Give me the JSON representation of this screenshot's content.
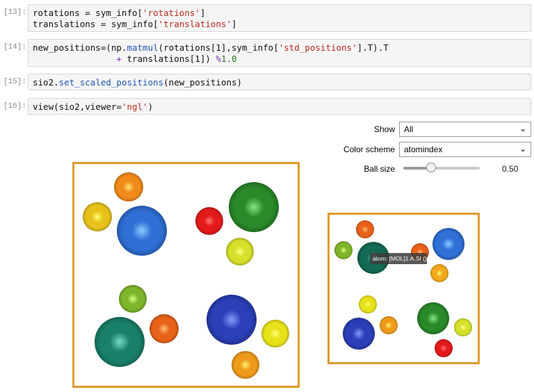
{
  "cells": [
    {
      "prompt": "[13]:",
      "lines": [
        [
          {
            "t": "rotations = sym_info[",
            "c": ""
          },
          {
            "t": "'rotations'",
            "c": "str"
          },
          {
            "t": "]",
            "c": ""
          }
        ],
        [
          {
            "t": "translations = sym_info[",
            "c": ""
          },
          {
            "t": "'translations'",
            "c": "str"
          },
          {
            "t": "]",
            "c": ""
          }
        ]
      ]
    },
    {
      "prompt": "[14]:",
      "lines": [
        [
          {
            "t": "new_positions=(np.",
            "c": ""
          },
          {
            "t": "matmul",
            "c": "fn"
          },
          {
            "t": "(rotations[1],sym_info[",
            "c": ""
          },
          {
            "t": "'std_positions'",
            "c": "str"
          },
          {
            "t": "].T).T",
            "c": ""
          }
        ],
        [
          {
            "t": "                ",
            "c": ""
          },
          {
            "t": "+",
            "c": "op"
          },
          {
            "t": " translations[1]) ",
            "c": ""
          },
          {
            "t": "%",
            "c": "op"
          },
          {
            "t": "1.0",
            "c": "num"
          }
        ]
      ]
    },
    {
      "prompt": "[15]:",
      "lines": [
        [
          {
            "t": "sio2.",
            "c": ""
          },
          {
            "t": "set_scaled_positions",
            "c": "fn"
          },
          {
            "t": "(new_positions)",
            "c": ""
          }
        ]
      ]
    },
    {
      "prompt": "[16]:",
      "lines": [
        [
          {
            "t": "view(sio2,viewer=",
            "c": ""
          },
          {
            "t": "'ngl'",
            "c": "str"
          },
          {
            "t": ")",
            "c": ""
          }
        ]
      ]
    }
  ],
  "controls": {
    "show_label": "Show",
    "show_value": "All",
    "color_label": "Color scheme",
    "color_value": "atomindex",
    "ballsize_label": "Ball size",
    "ballsize_value": "0.50",
    "ballsize_fraction": 0.36
  },
  "tooltip": "atom: [MOL]1:A.SI ()",
  "viewer_main": {
    "atoms": [
      {
        "color": "#f08a1a",
        "size": "m"
      },
      {
        "color": "#e8c21a",
        "size": "m"
      },
      {
        "color": "#2f6fd6",
        "size": "xl"
      },
      {
        "color": "#e31a1a",
        "size": "m"
      },
      {
        "color": "#2a8a2a",
        "size": "xl"
      },
      {
        "color": "#d4e02a",
        "size": "m"
      },
      {
        "color": "#7fb52a",
        "size": "m"
      },
      {
        "color": "#19806a",
        "size": "xl"
      },
      {
        "color": "#e8621a",
        "size": "m"
      },
      {
        "color": "#2a3fb8",
        "size": "xl"
      },
      {
        "color": "#e8e21a",
        "size": "m"
      },
      {
        "color": "#f09a1a",
        "size": "m"
      }
    ]
  },
  "viewer_small": {
    "atoms": [
      {
        "color": "#e8621a",
        "size": "s"
      },
      {
        "color": "#7fb52a",
        "size": "s"
      },
      {
        "color": "#136a55",
        "size": "l"
      },
      {
        "color": "#e8621a",
        "size": "s"
      },
      {
        "color": "#2f6fd6",
        "size": "l"
      },
      {
        "color": "#f0a81a",
        "size": "s"
      },
      {
        "color": "#e8e21a",
        "size": "s"
      },
      {
        "color": "#f09a1a",
        "size": "s"
      },
      {
        "color": "#2a3fb8",
        "size": "l"
      },
      {
        "color": "#2a8a2a",
        "size": "l"
      },
      {
        "color": "#d4e02a",
        "size": "s"
      },
      {
        "color": "#e31a1a",
        "size": "s"
      }
    ]
  }
}
